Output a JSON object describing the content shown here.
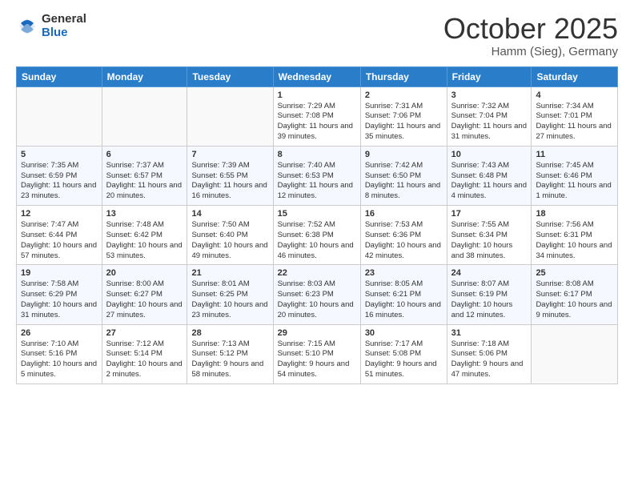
{
  "logo": {
    "general": "General",
    "blue": "Blue"
  },
  "title": {
    "month": "October 2025",
    "location": "Hamm (Sieg), Germany"
  },
  "days_of_week": [
    "Sunday",
    "Monday",
    "Tuesday",
    "Wednesday",
    "Thursday",
    "Friday",
    "Saturday"
  ],
  "weeks": [
    [
      {
        "day": "",
        "info": ""
      },
      {
        "day": "",
        "info": ""
      },
      {
        "day": "",
        "info": ""
      },
      {
        "day": "1",
        "info": "Sunrise: 7:29 AM\nSunset: 7:08 PM\nDaylight: 11 hours and 39 minutes."
      },
      {
        "day": "2",
        "info": "Sunrise: 7:31 AM\nSunset: 7:06 PM\nDaylight: 11 hours and 35 minutes."
      },
      {
        "day": "3",
        "info": "Sunrise: 7:32 AM\nSunset: 7:04 PM\nDaylight: 11 hours and 31 minutes."
      },
      {
        "day": "4",
        "info": "Sunrise: 7:34 AM\nSunset: 7:01 PM\nDaylight: 11 hours and 27 minutes."
      }
    ],
    [
      {
        "day": "5",
        "info": "Sunrise: 7:35 AM\nSunset: 6:59 PM\nDaylight: 11 hours and 23 minutes."
      },
      {
        "day": "6",
        "info": "Sunrise: 7:37 AM\nSunset: 6:57 PM\nDaylight: 11 hours and 20 minutes."
      },
      {
        "day": "7",
        "info": "Sunrise: 7:39 AM\nSunset: 6:55 PM\nDaylight: 11 hours and 16 minutes."
      },
      {
        "day": "8",
        "info": "Sunrise: 7:40 AM\nSunset: 6:53 PM\nDaylight: 11 hours and 12 minutes."
      },
      {
        "day": "9",
        "info": "Sunrise: 7:42 AM\nSunset: 6:50 PM\nDaylight: 11 hours and 8 minutes."
      },
      {
        "day": "10",
        "info": "Sunrise: 7:43 AM\nSunset: 6:48 PM\nDaylight: 11 hours and 4 minutes."
      },
      {
        "day": "11",
        "info": "Sunrise: 7:45 AM\nSunset: 6:46 PM\nDaylight: 11 hours and 1 minute."
      }
    ],
    [
      {
        "day": "12",
        "info": "Sunrise: 7:47 AM\nSunset: 6:44 PM\nDaylight: 10 hours and 57 minutes."
      },
      {
        "day": "13",
        "info": "Sunrise: 7:48 AM\nSunset: 6:42 PM\nDaylight: 10 hours and 53 minutes."
      },
      {
        "day": "14",
        "info": "Sunrise: 7:50 AM\nSunset: 6:40 PM\nDaylight: 10 hours and 49 minutes."
      },
      {
        "day": "15",
        "info": "Sunrise: 7:52 AM\nSunset: 6:38 PM\nDaylight: 10 hours and 46 minutes."
      },
      {
        "day": "16",
        "info": "Sunrise: 7:53 AM\nSunset: 6:36 PM\nDaylight: 10 hours and 42 minutes."
      },
      {
        "day": "17",
        "info": "Sunrise: 7:55 AM\nSunset: 6:34 PM\nDaylight: 10 hours and 38 minutes."
      },
      {
        "day": "18",
        "info": "Sunrise: 7:56 AM\nSunset: 6:31 PM\nDaylight: 10 hours and 34 minutes."
      }
    ],
    [
      {
        "day": "19",
        "info": "Sunrise: 7:58 AM\nSunset: 6:29 PM\nDaylight: 10 hours and 31 minutes."
      },
      {
        "day": "20",
        "info": "Sunrise: 8:00 AM\nSunset: 6:27 PM\nDaylight: 10 hours and 27 minutes."
      },
      {
        "day": "21",
        "info": "Sunrise: 8:01 AM\nSunset: 6:25 PM\nDaylight: 10 hours and 23 minutes."
      },
      {
        "day": "22",
        "info": "Sunrise: 8:03 AM\nSunset: 6:23 PM\nDaylight: 10 hours and 20 minutes."
      },
      {
        "day": "23",
        "info": "Sunrise: 8:05 AM\nSunset: 6:21 PM\nDaylight: 10 hours and 16 minutes."
      },
      {
        "day": "24",
        "info": "Sunrise: 8:07 AM\nSunset: 6:19 PM\nDaylight: 10 hours and 12 minutes."
      },
      {
        "day": "25",
        "info": "Sunrise: 8:08 AM\nSunset: 6:17 PM\nDaylight: 10 hours and 9 minutes."
      }
    ],
    [
      {
        "day": "26",
        "info": "Sunrise: 7:10 AM\nSunset: 5:16 PM\nDaylight: 10 hours and 5 minutes."
      },
      {
        "day": "27",
        "info": "Sunrise: 7:12 AM\nSunset: 5:14 PM\nDaylight: 10 hours and 2 minutes."
      },
      {
        "day": "28",
        "info": "Sunrise: 7:13 AM\nSunset: 5:12 PM\nDaylight: 9 hours and 58 minutes."
      },
      {
        "day": "29",
        "info": "Sunrise: 7:15 AM\nSunset: 5:10 PM\nDaylight: 9 hours and 54 minutes."
      },
      {
        "day": "30",
        "info": "Sunrise: 7:17 AM\nSunset: 5:08 PM\nDaylight: 9 hours and 51 minutes."
      },
      {
        "day": "31",
        "info": "Sunrise: 7:18 AM\nSunset: 5:06 PM\nDaylight: 9 hours and 47 minutes."
      },
      {
        "day": "",
        "info": ""
      }
    ]
  ]
}
